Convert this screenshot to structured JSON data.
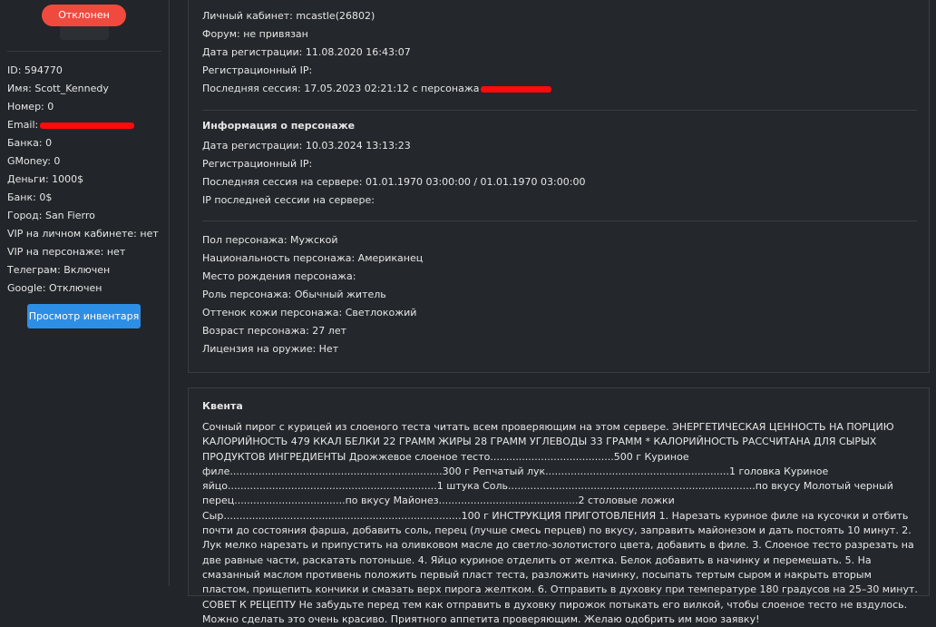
{
  "sidebar": {
    "status_badge": "Отклонен",
    "info": [
      "ID: 594770",
      "Имя: Scott_Kennedy",
      "Номер: 0",
      "Email:",
      "Банка: 0",
      "GMoney: 0",
      "Деньги: 1000$",
      "Банк: 0$",
      "Город: San Fierro",
      "VIP на личном кабинете: нет",
      "VIP на персонаже: нет",
      "Телеграм: Включен",
      "Google: Отключен"
    ],
    "inventory_button": "Просмотр инвентаря"
  },
  "account": {
    "cabinet": "Личный кабинет: mcastle(26802)",
    "forum": "Форум: не привязан",
    "reg_date": "Дата регистрации: 11.08.2020 16:43:07",
    "reg_ip": "Регистрационный IP:",
    "last_session": "Последняя сессия: 17.05.2023 02:21:12 с персонажа"
  },
  "character": {
    "heading": "Информация о персонаже",
    "reg_date": "Дата регистрации: 10.03.2024 13:13:23",
    "reg_ip": "Регистрационный IP:",
    "last_session": "Последняя сессия на сервере: 01.01.1970 03:00:00 / 01.01.1970 03:00:00",
    "last_ip": "IP последней сессии на сервере:",
    "gender": "Пол персонажа: Мужской",
    "nationality": "Национальность персонажа: Американец",
    "birthplace": "Место рождения персонажа:",
    "role": "Роль персонажа: Обычный житель",
    "skin": "Оттенок кожи персонажа: Светлокожий",
    "age": "Возраст персонажа: 27 лет",
    "license": "Лицензия на оружие: Нет"
  },
  "quenta": {
    "heading": "Квента",
    "text": "Сочный пирог с курицей из слоеного теста читать всем проверяющим на этом сервере. ЭНЕРГЕТИЧЕСКАЯ ЦЕННОСТЬ НА ПОРЦИЮ КАЛОРИЙНОСТЬ 479 ККАЛ БЕЛКИ 22 ГРАММ ЖИРЫ 28 ГРАММ УГЛЕВОДЫ 33 ГРАММ * КАЛОРИЙНОСТЬ РАССЧИТАНА ДЛЯ СЫРЫХ ПРОДУКТОВ ИНГРЕДИЕНТЫ Дрожжевое слоеное тесто.......................................500 г Куриное филе...................................................................300 г Репчатый лук..........................................................1 головка Куриное яйцо..................................................................1 штука Соль..............................................................................по вкусу Молотый черный перец...................................по вкусу Майонез............................................2 столовые ложки Сыр...........................................................................100 г ИНСТРУКЦИЯ ПРИГОТОВЛЕНИЯ 1. Нарезать куриное филе на кусочки и отбить почти до состояния фарша, добавить соль, перец (лучше смесь перцев) по вкусу, заправить майонезом и дать постоять 10 минут. 2. Лук мелко нарезать и припустить на оливковом масле до светло-золотистого цвета, добавить в филе. 3. Слоеное тесто разрезать на две равные части, раскатать потоньше. 4. Яйцо куриное отделить от желтка. Белок добавить в начинку и перемешать. 5. На смазанный маслом противень положить первый пласт теста, разложить начинку, посыпать тертым сыром и накрыть вторым пластом, прищепить кончики и смазать верх пирога желтком. 6. Отправить в духовку при температуре 180 градусов на 25–30 минут. СОВЕТ К РЕЦЕПТУ Не забудьте перед тем как отправить в духовку пирожок потыкать его вилкой, чтобы слоеное тесто не вздулось. Можно сделать это очень красиво. Приятного аппетита проверяющим. Желаю одобрить им мою заявку!"
  },
  "colors": {
    "background": "#222529",
    "status_rejected": "#f04a3e",
    "button_primary": "#2d8ee6",
    "redaction": "#ff0b0b"
  }
}
